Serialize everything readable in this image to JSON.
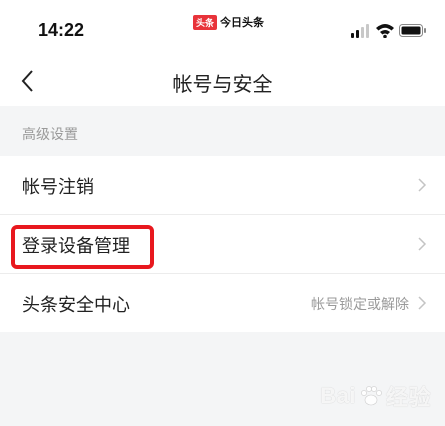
{
  "status_bar": {
    "time": "14:22",
    "app_badge_logo": "头条",
    "app_badge_name": "今日头条",
    "icons": [
      "signal-icon",
      "wifi-icon",
      "battery-icon"
    ]
  },
  "nav": {
    "title": "帐号与安全",
    "back_icon": "chevron-left-icon"
  },
  "section": {
    "header": "高级设置"
  },
  "rows": [
    {
      "label": "帐号注销",
      "value": ""
    },
    {
      "label": "登录设备管理",
      "value": ""
    },
    {
      "label": "头条安全中心",
      "value": "帐号锁定或解除"
    }
  ],
  "watermark": {
    "left": "Bai",
    "right": "经验"
  },
  "colors": {
    "highlight": "#e8181e",
    "background": "#f4f5f6",
    "muted_text": "#9a9a9a",
    "brand_red": "#e8333a"
  }
}
